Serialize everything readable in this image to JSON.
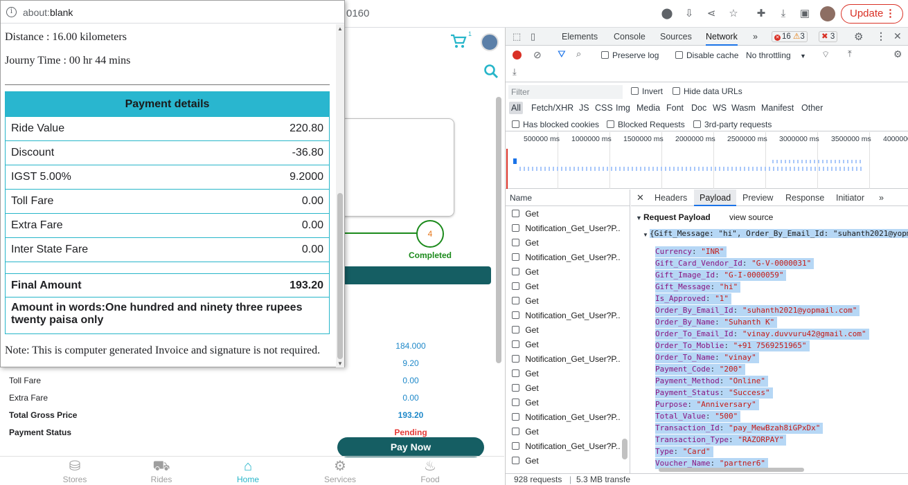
{
  "browser": {
    "url_fragment": "0160",
    "update_label": "Update",
    "update_menu": "⋮"
  },
  "popup": {
    "address_prefix": "about:",
    "address_main": "blank",
    "distance": "Distance : 16.00 kilometers",
    "journey": "Journy Time : 00 hr 44 mins",
    "payment_title": "Payment details",
    "rows": [
      {
        "label": "Ride Value",
        "value": "220.80"
      },
      {
        "label": "Discount",
        "value": "-36.80"
      },
      {
        "label": "IGST 5.00%",
        "value": "9.2000"
      },
      {
        "label": "Toll Fare",
        "value": "0.00"
      },
      {
        "label": "Extra Fare",
        "value": "0.00"
      },
      {
        "label": "Inter State Fare",
        "value": "0.00"
      }
    ],
    "final_label": "Final Amount",
    "final_value": "193.20",
    "amount_words": "Amount in words:One hundred and ninety three rupees twenty paisa only",
    "note": "Note: This is computer generated Invoice and signature is not required."
  },
  "app": {
    "cart_count": "1",
    "step_number": "4",
    "step_label": "Completed",
    "bg_values": [
      "184.000",
      "9.20",
      "0.00",
      "0.00"
    ],
    "toll_label": "Toll Fare",
    "extra_label": "Extra Fare",
    "gross_label": "Total Gross Price",
    "gross_value": "193.20",
    "status_label": "Payment Status",
    "status_value": "Pending",
    "pay_now": "Pay Now",
    "nav": [
      {
        "label": "Stores",
        "icon": "store-icon"
      },
      {
        "label": "Rides",
        "icon": "car-icon"
      },
      {
        "label": "Home",
        "icon": "home-icon"
      },
      {
        "label": "Services",
        "icon": "gears-icon"
      },
      {
        "label": "Food",
        "icon": "food-icon"
      }
    ]
  },
  "devtools": {
    "tabs": [
      "Elements",
      "Console",
      "Sources",
      "Network",
      "»"
    ],
    "active_tab": "Network",
    "errors": "16",
    "warnings": "3",
    "issues": "3",
    "preserve_log": "Preserve log",
    "disable_cache": "Disable cache",
    "throttling": "No throttling",
    "filter_placeholder": "Filter",
    "invert": "Invert",
    "hide_data_urls": "Hide data URLs",
    "types": [
      "All",
      "Fetch/XHR",
      "JS",
      "CSS",
      "Img",
      "Media",
      "Font",
      "Doc",
      "WS",
      "Wasm",
      "Manifest",
      "Other"
    ],
    "has_blocked_cookies": "Has blocked cookies",
    "blocked_requests": "Blocked Requests",
    "third_party": "3rd-party requests",
    "timeline_ticks": [
      "500000 ms",
      "1000000 ms",
      "1500000 ms",
      "2000000 ms",
      "2500000 ms",
      "3000000 ms",
      "3500000 ms",
      "4000000"
    ],
    "name_header": "Name",
    "requests": [
      "Get",
      "Notification_Get_User?P...",
      "Get",
      "Notification_Get_User?P...",
      "Get",
      "Get",
      "Get",
      "Notification_Get_User?P...",
      "Get",
      "Get",
      "Notification_Get_User?P...",
      "Get",
      "Get",
      "Get",
      "Notification_Get_User?P...",
      "Get",
      "Notification_Get_User?P...",
      "Get"
    ],
    "request_count": "928 requests",
    "transferred": "5.3 MB transfe",
    "detail_tabs": [
      "Headers",
      "Payload",
      "Preview",
      "Response",
      "Initiator",
      "»"
    ],
    "active_detail_tab": "Payload",
    "payload_title": "Request Payload",
    "view_source": "view source",
    "summary": "{Gift_Message: \"hi\", Order_By_Email_Id: \"suhanth2021@yopm",
    "payload": [
      {
        "key": "Currency",
        "value": "\"INR\""
      },
      {
        "key": "Gift_Card_Vendor_Id",
        "value": "\"G-V-0000031\""
      },
      {
        "key": "Gift_Image_Id",
        "value": "\"G-I-0000059\""
      },
      {
        "key": "Gift_Message",
        "value": "\"hi\""
      },
      {
        "key": "Is_Approved",
        "value": "\"1\""
      },
      {
        "key": "Order_By_Email_Id",
        "value": "\"suhanth2021@yopmail.com\""
      },
      {
        "key": "Order_By_Name",
        "value": "\"Suhanth K\""
      },
      {
        "key": "Order_To_Email_Id",
        "value": "\"vinay.duvvuru42@gmail.com\""
      },
      {
        "key": "Order_To_Moblie",
        "value": "\"+91 7569251965\""
      },
      {
        "key": "Order_To_Name",
        "value": "\"vinay\""
      },
      {
        "key": "Payment_Code",
        "value": "\"200\""
      },
      {
        "key": "Payment_Method",
        "value": "\"Online\""
      },
      {
        "key": "Payment_Status",
        "value": "\"Success\""
      },
      {
        "key": "Purpose",
        "value": "\"Anniversary\""
      },
      {
        "key": "Total_Value",
        "value": "\"500\""
      },
      {
        "key": "Transaction_Id",
        "value": "\"pay_MewBzah8iGPxDx\""
      },
      {
        "key": "Transaction_Type",
        "value": "\"RAZORPAY\""
      },
      {
        "key": "Type",
        "value": "\"Card\""
      },
      {
        "key": "Voucher_Name",
        "value": "\"partner6\""
      }
    ]
  }
}
